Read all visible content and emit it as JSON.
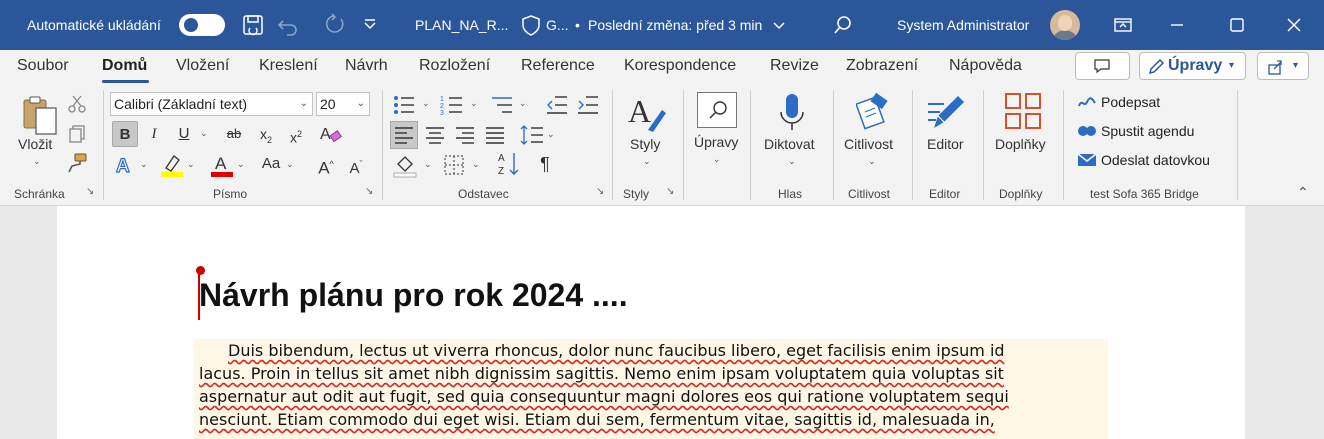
{
  "titlebar": {
    "autosave_label": "Automatické ukládání",
    "autosave_state": "on",
    "filename": "PLAN_NA_R...",
    "sensitivity": "G...",
    "last_change": "Poslední změna: před 3 min",
    "user": "System Administrator"
  },
  "tabs": [
    "Soubor",
    "Domů",
    "Vložení",
    "Kreslení",
    "Návrh",
    "Rozložení",
    "Reference",
    "Korespondence",
    "Revize",
    "Zobrazení",
    "Nápověda"
  ],
  "active_tab": "Domů",
  "ribbon_right": {
    "editing_button": "Úpravy"
  },
  "ribbon": {
    "clipboard": {
      "paste": "Vložit",
      "group": "Schránka"
    },
    "font": {
      "family": "Calibri (Základní text)",
      "size": "20",
      "group": "Písmo"
    },
    "paragraph": {
      "group": "Odstavec"
    },
    "styles": {
      "label": "Styly",
      "group": "Styly"
    },
    "editing": {
      "label": "Úpravy"
    },
    "voice": {
      "label": "Diktovat",
      "group": "Hlas"
    },
    "sensitivity": {
      "label": "Citlivost",
      "group": "Citlivost"
    },
    "editor": {
      "label": "Editor",
      "group": "Editor"
    },
    "addins": {
      "label": "Doplňky",
      "group": "Doplňky"
    },
    "sofa": {
      "items": [
        "Podepsat",
        "Spustit agendu",
        "Odeslat datovkou"
      ],
      "group": "test Sofa 365 Bridge"
    }
  },
  "colors": {
    "brand": "#2b579a",
    "highlight": "#ffff00",
    "font_color": "#e00000"
  },
  "document": {
    "heading": "Návrh plánu pro rok 2024 ....",
    "lines": [
      "Duis bibendum, lectus ut viverra rhoncus, dolor nunc faucibus libero, eget facilisis enim ipsum id",
      "lacus. Proin in tellus sit amet nibh dignissim sagittis. Nemo enim ipsam voluptatem quia voluptas sit",
      "aspernatur aut odit aut fugit, sed quia consequuntur magni dolores eos qui ratione voluptatem sequi",
      "nesciunt. Etiam commodo dui eget wisi. Etiam dui sem, fermentum vitae, sagittis id, malesuada in,"
    ]
  }
}
